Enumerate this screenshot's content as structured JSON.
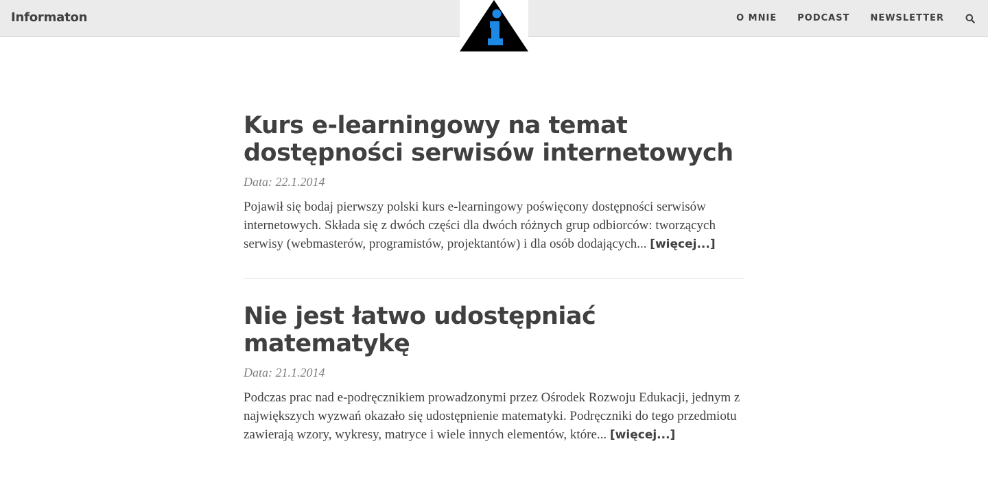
{
  "nav": {
    "brand": "Informaton",
    "links": [
      "O MNIE",
      "PODCAST",
      "NEWSLETTER"
    ],
    "search_icon": "search-icon"
  },
  "logo": {
    "icon": "info-triangle-icon",
    "colors": {
      "triangle": "#000000",
      "glyph": "#1e88e5"
    }
  },
  "posts": [
    {
      "title": "Kurs e-learningowy na temat dostępności serwisów internetowych",
      "date": "Data: 22.1.2014",
      "excerpt": "Pojawił się bodaj pierwszy polski kurs e-learningowy poświęcony dostępności serwisów internetowych. Składa się z dwóch części dla dwóch różnych grup odbiorców: tworzących serwisy (webmasterów, programistów, projektantów) i dla osób dodających...",
      "more": "[więcej...]"
    },
    {
      "title": "Nie jest łatwo udostępniać matematykę",
      "date": "Data: 21.1.2014",
      "excerpt": "Podczas prac nad e-podręcznikiem prowadzonymi przez Ośrodek Rozwoju Edukacji, jednym z największych wyzwań okazało się udostępnienie matematyki. Podręczniki do tego przedmiotu zawierają wzory, wykresy, matryce i wiele innych elementów, które...",
      "more": "[więcej...]"
    }
  ],
  "colors": {
    "navbar_bg": "#ebebeb",
    "text": "#404040",
    "meta": "#808080"
  }
}
